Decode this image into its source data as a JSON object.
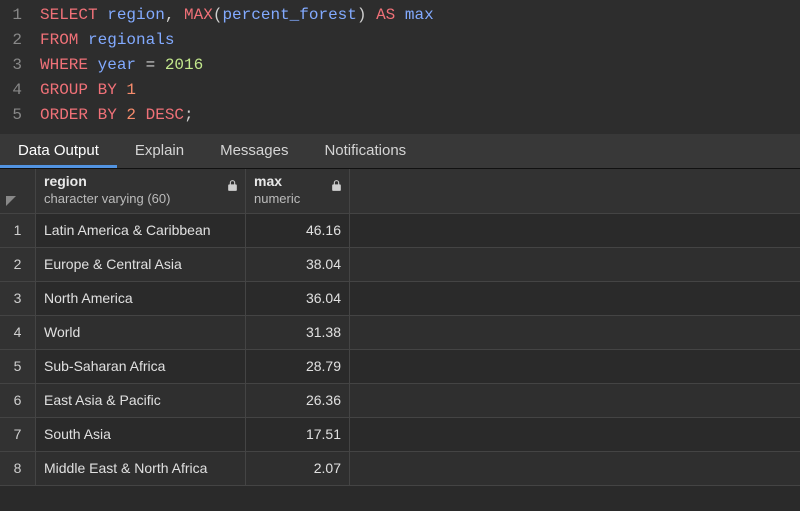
{
  "editor": {
    "lines": [
      {
        "num": "1",
        "tokens": [
          [
            "kw",
            "SELECT "
          ],
          [
            "ident",
            "region"
          ],
          [
            "white",
            ", "
          ],
          [
            "kw",
            "MAX"
          ],
          [
            "white",
            "("
          ],
          [
            "ident",
            "percent_forest"
          ],
          [
            "white",
            ") "
          ],
          [
            "kw",
            "AS "
          ],
          [
            "ident",
            "max"
          ]
        ]
      },
      {
        "num": "2",
        "tokens": [
          [
            "kw",
            "FROM "
          ],
          [
            "ident",
            "regionals"
          ]
        ]
      },
      {
        "num": "3",
        "tokens": [
          [
            "kw",
            "WHERE "
          ],
          [
            "ident",
            "year "
          ],
          [
            "white",
            "= "
          ],
          [
            "num",
            "2016"
          ]
        ]
      },
      {
        "num": "4",
        "tokens": [
          [
            "kw",
            "GROUP BY "
          ],
          [
            "intlit",
            "1"
          ]
        ]
      },
      {
        "num": "5",
        "tokens": [
          [
            "kw",
            "ORDER BY "
          ],
          [
            "intlit",
            "2 "
          ],
          [
            "kw",
            "DESC"
          ],
          [
            "white",
            ";"
          ]
        ]
      }
    ]
  },
  "tabs": {
    "data_output": "Data Output",
    "explain": "Explain",
    "messages": "Messages",
    "notifications": "Notifications"
  },
  "columns": {
    "region": {
      "name": "region",
      "type": "character varying (60)"
    },
    "max": {
      "name": "max",
      "type": "numeric"
    }
  },
  "rows": [
    {
      "n": "1",
      "region": "Latin America & Caribbean",
      "max": "46.16"
    },
    {
      "n": "2",
      "region": "Europe & Central Asia",
      "max": "38.04"
    },
    {
      "n": "3",
      "region": "North America",
      "max": "36.04"
    },
    {
      "n": "4",
      "region": "World",
      "max": "31.38"
    },
    {
      "n": "5",
      "region": "Sub-Saharan Africa",
      "max": "28.79"
    },
    {
      "n": "6",
      "region": "East Asia & Pacific",
      "max": "26.36"
    },
    {
      "n": "7",
      "region": "South Asia",
      "max": "17.51"
    },
    {
      "n": "8",
      "region": "Middle East & North Africa",
      "max": "2.07"
    }
  ]
}
